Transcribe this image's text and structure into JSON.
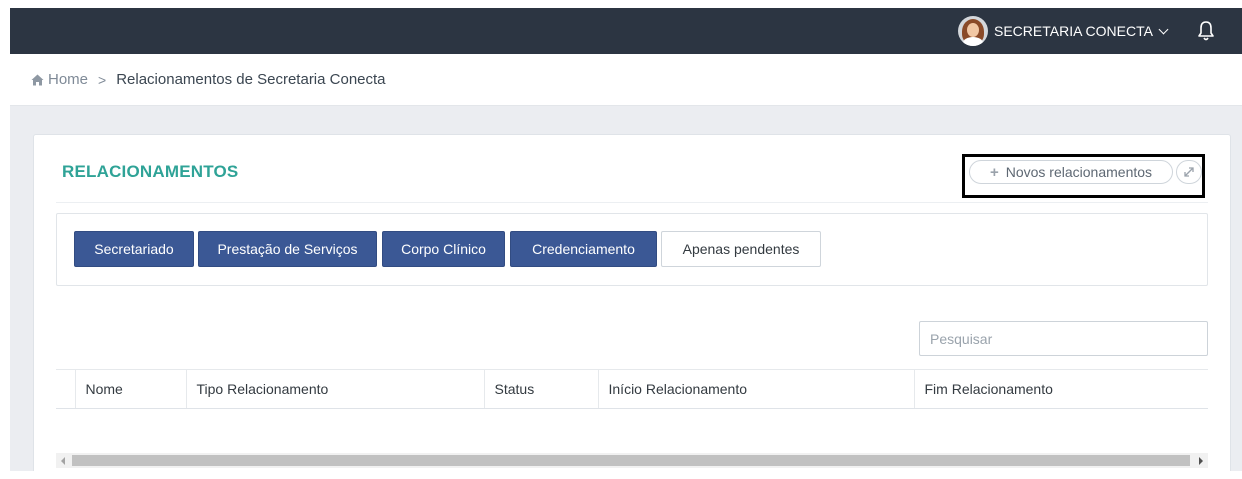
{
  "header": {
    "user_name": "SECRETARIA CONECTA",
    "avatar_icon": "user-avatar",
    "notification_icon": "bell-icon"
  },
  "breadcrumb": {
    "home": "Home",
    "separator": ">",
    "current": "Relacionamentos de Secretaria Conecta"
  },
  "panel": {
    "title": "RELACIONAMENTOS",
    "new_button": "Novos relacionamentos",
    "expand_icon": "expand-icon",
    "accent_color": "#2fa397"
  },
  "filters": {
    "buttons": [
      "Secretariado",
      "Prestação de Serviços",
      "Corpo Clínico",
      "Credenciamento",
      "Apenas pendentes"
    ],
    "primary_color": "#3b5895"
  },
  "search": {
    "placeholder": "Pesquisar"
  },
  "table": {
    "columns": [
      "",
      "Nome",
      "Tipo Relacionamento",
      "Status",
      "Início Relacionamento",
      "Fim Relacionamento"
    ]
  }
}
